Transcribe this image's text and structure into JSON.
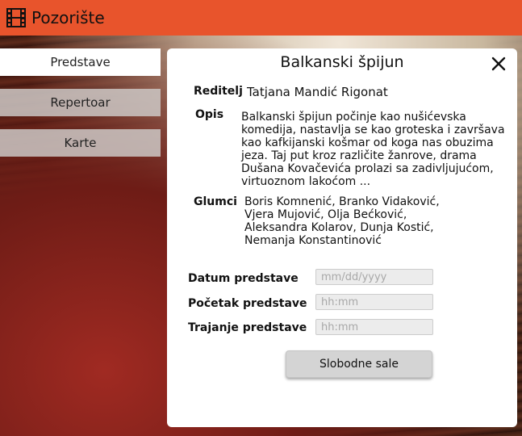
{
  "app": {
    "title": "Pozorište",
    "logo_icon": "film-strip-icon"
  },
  "colors": {
    "topbar": "#e8542c",
    "card": "#ffffff",
    "nav_active": "#ffffff",
    "nav_inactive": "#cdc8c6"
  },
  "sidebar": {
    "items": [
      {
        "label": "Predstave",
        "active": true
      },
      {
        "label": "Repertoar",
        "active": false
      },
      {
        "label": "Karte",
        "active": false
      }
    ]
  },
  "details": {
    "title": "Balkanski špijun",
    "close_icon": "close-icon",
    "director_label": "Reditelj",
    "director": "Tatjana Mandić Rigonat",
    "description_label": "Opis",
    "description_lines": [
      "Balkanski špijun počinje kao nušićevska",
      "komedija, nastavlja se kao groteska i završava",
      "kao kafkijanski košmar od koga nas obuzima",
      "jeza. Taj put kroz različite žanrove, drama",
      "Dušana Kovačevića prolazi sa zadivljujućom,",
      "virtuoznom lakoćom  ..."
    ],
    "actors_label": "Glumci",
    "actors_lines": [
      "Boris Komnenić, Branko Vidaković,",
      "Vjera Mujović, Olja Bećković,",
      "Aleksandra Kolarov, Dunja Kostić,",
      "Nemanja Konstantinović"
    ]
  },
  "form": {
    "date_label": "Datum predstave",
    "date_placeholder": "mm/dd/yyyy",
    "start_label": "Početak predstave",
    "start_placeholder": "hh:mm",
    "duration_label": "Trajanje predstave",
    "duration_placeholder": "hh:mm",
    "submit_label": "Slobodne sale"
  }
}
